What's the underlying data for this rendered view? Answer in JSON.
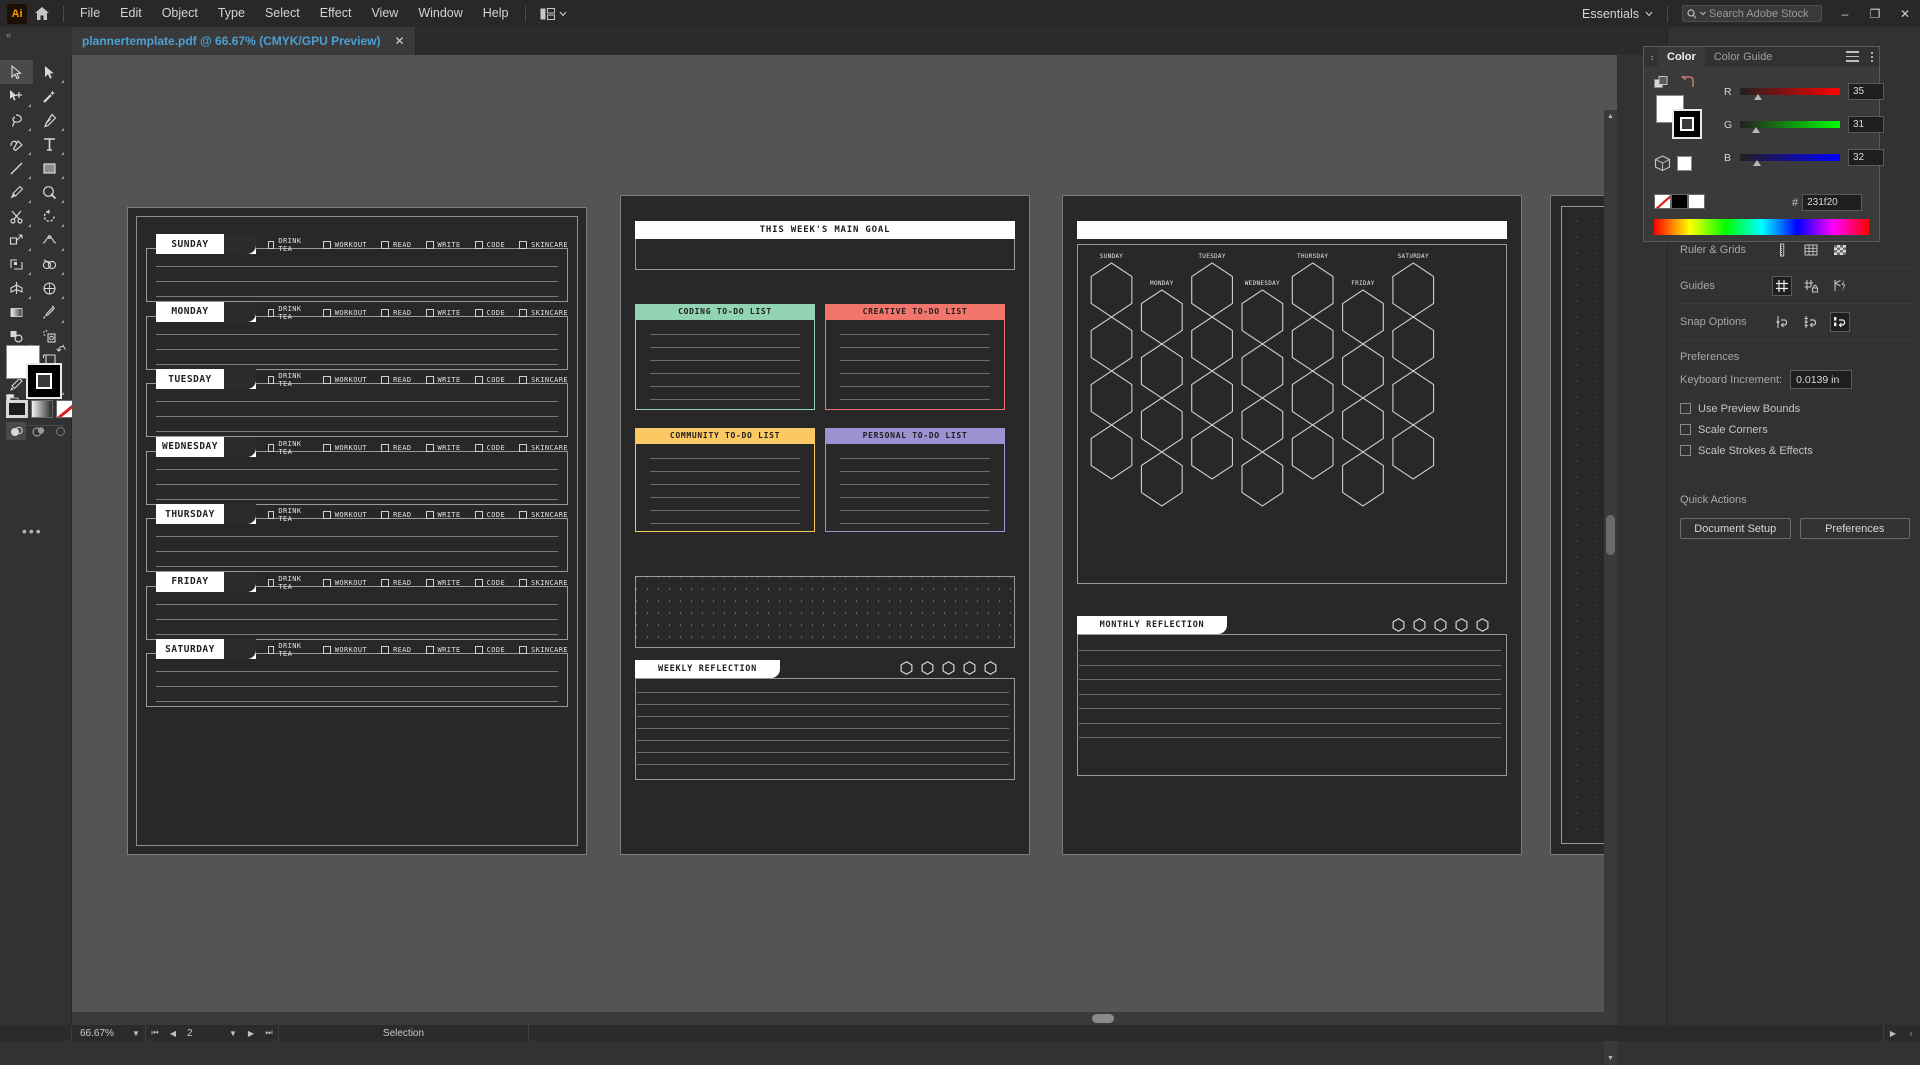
{
  "app": {
    "logo": "Ai",
    "home_icon": "home-icon"
  },
  "menu": {
    "items": [
      "File",
      "Edit",
      "Object",
      "Type",
      "Select",
      "Effect",
      "View",
      "Window",
      "Help"
    ]
  },
  "workspace": {
    "name": "Essentials"
  },
  "search": {
    "placeholder": "Search Adobe Stock",
    "icon": "search-icon"
  },
  "window_controls": {
    "minimize": "–",
    "restore": "❐",
    "close": "✕"
  },
  "tab": {
    "title": "plannertemplate.pdf @ 66.67% (CMYK/GPU Preview)",
    "close": "✕"
  },
  "toolbar": {
    "tools": [
      [
        "selection-tool",
        "direct-selection-tool"
      ],
      [
        "group-selection-tool",
        "magic-wand-tool"
      ],
      [
        "lasso-tool",
        "pen-tool"
      ],
      [
        "curvature-tool",
        "type-tool"
      ],
      [
        "line-segment-tool",
        "rectangle-tool"
      ],
      [
        "paintbrush-tool",
        "shaper-tool"
      ],
      [
        "scissors-tool",
        "rotate-tool"
      ],
      [
        "scale-tool",
        "width-tool"
      ],
      [
        "free-transform-tool",
        "shape-builder-tool"
      ],
      [
        "perspective-grid-tool",
        "mesh-tool"
      ],
      [
        "gradient-tool",
        "eyedropper-tool"
      ],
      [
        "blend-tool",
        "symbol-sprayer-tool"
      ],
      [
        "column-graph-tool",
        "artboard-tool"
      ],
      [
        "slice-tool",
        "hand-tool"
      ],
      [
        "zoom-tool",
        ""
      ]
    ],
    "fill_color": "#ffffff",
    "stroke_color": "#000000",
    "more_tools": "•••"
  },
  "color_panel": {
    "tabs": [
      {
        "label": "Color",
        "active": true
      },
      {
        "label": "Color Guide",
        "active": false
      }
    ],
    "menu_icon": "hamburger-icon",
    "channels": [
      {
        "name": "R",
        "value": "35",
        "pos": 13.7
      },
      {
        "name": "G",
        "value": "31",
        "pos": 12.2
      },
      {
        "name": "B",
        "value": "32",
        "pos": 12.5
      }
    ],
    "hex_label": "#",
    "hex_value": "231f20",
    "fill_swatch": "#ffffff",
    "stroke_swatch": "#000000"
  },
  "properties": {
    "rows": [
      {
        "label": "Ruler & Grids",
        "icons": [
          "rulers-icon",
          "grid-icon",
          "transparency-grid-icon"
        ],
        "active": -1
      },
      {
        "label": "Guides",
        "icons": [
          "show-guides-icon",
          "lock-guides-icon",
          "smart-guides-icon"
        ],
        "active": 0
      },
      {
        "label": "Snap Options",
        "icons": [
          "snap-to-point-icon",
          "snap-to-grid-icon",
          "snap-to-pixel-icon"
        ],
        "active": 2
      }
    ],
    "preferences_label": "Preferences",
    "keyboard_increment_label": "Keyboard Increment:",
    "keyboard_increment_value": "0.0139 in",
    "checkboxes": [
      {
        "label": "Use Preview Bounds",
        "checked": false
      },
      {
        "label": "Scale Corners",
        "checked": false
      },
      {
        "label": "Scale Strokes & Effects",
        "checked": false
      }
    ],
    "quick_actions_label": "Quick Actions",
    "buttons": [
      "Document Setup",
      "Preferences"
    ]
  },
  "status_bar": {
    "zoom": "66.67%",
    "page": "2",
    "tool": "Selection",
    "first_icon": "first-page-icon",
    "prev_icon": "prev-page-icon",
    "next_icon": "next-page-icon",
    "last_icon": "last-page-icon"
  },
  "artwork": {
    "weekly_planner": {
      "days": [
        "SUNDAY",
        "MONDAY",
        "TUESDAY",
        "WEDNESDAY",
        "THURSDAY",
        "FRIDAY",
        "SATURDAY"
      ],
      "habits": [
        "DRINK TEA",
        "WORKOUT",
        "READ",
        "WRITE",
        "CODE",
        "SKINCARE"
      ],
      "lines_per_day": 3
    },
    "todo_page": {
      "main_goal_title": "THIS WEEK'S MAIN GOAL",
      "lists": [
        {
          "title": "CODING TO-DO LIST",
          "color": "#92d3b4",
          "lines": 6
        },
        {
          "title": "CREATIVE TO-DO LIST",
          "color": "#f2756b",
          "lines": 6
        },
        {
          "title": "COMMUNITY TO-DO LIST",
          "color": "#fcc košo",
          "lines": 6
        },
        {
          "title": "PERSONAL TO-DO LIST",
          "color": "#9b93d1",
          "lines": 6
        }
      ],
      "reflection_title": "WEEKLY REFLECTION",
      "rating_hexes": 5,
      "reflection_lines": 7
    },
    "monthly_page": {
      "weekday_labels": [
        "SUNDAY",
        "MONDAY",
        "TUESDAY",
        "WEDNESDAY",
        "THURSDAY",
        "FRIDAY",
        "SATURDAY"
      ],
      "reflection_title": "MONTHLY REFLECTION",
      "rating_hexes": 5,
      "reflection_lines": 7
    }
  }
}
